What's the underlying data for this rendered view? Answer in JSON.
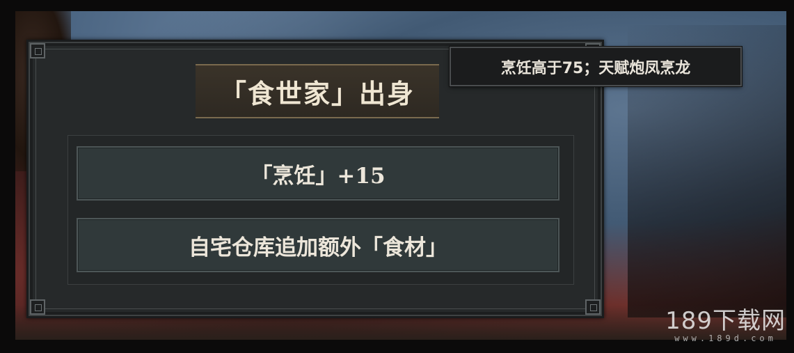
{
  "panel": {
    "title": "「食世家」出身",
    "bonuses": [
      {
        "text": "「烹饪」+15"
      },
      {
        "text": "自宅仓库追加额外「食材」"
      }
    ]
  },
  "condition": {
    "text": "烹饪高于75；天赋炮凤烹龙"
  },
  "watermark": {
    "main": "189下载网",
    "sub": "www.189d.com"
  }
}
